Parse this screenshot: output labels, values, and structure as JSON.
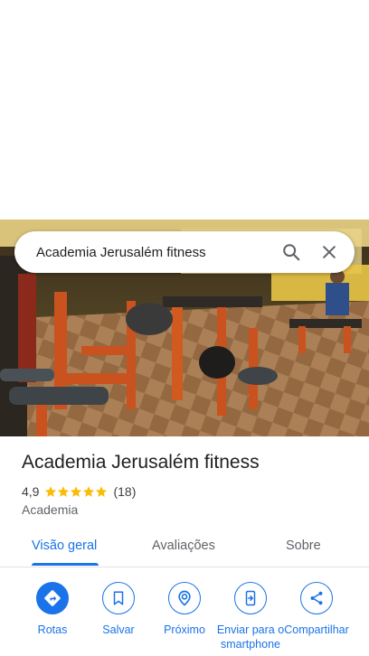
{
  "search": {
    "query": "Academia Jerusalém fitness",
    "search_icon": "search-icon",
    "close_icon": "close-icon"
  },
  "hero": {
    "photo": "gym-interior-photo"
  },
  "place": {
    "name": "Academia Jerusalém fitness",
    "rating": "4,9",
    "rating_value": 4.9,
    "stars": 5,
    "review_count": "(18)",
    "category": "Academia"
  },
  "tabs": [
    {
      "label": "Visão geral",
      "active": true
    },
    {
      "label": "Avaliações",
      "active": false
    },
    {
      "label": "Sobre",
      "active": false
    }
  ],
  "actions": [
    {
      "label": "Rotas",
      "icon": "directions-icon"
    },
    {
      "label": "Salvar",
      "icon": "bookmark-icon"
    },
    {
      "label": "Próximo",
      "icon": "nearby-icon"
    },
    {
      "label": "Enviar para o smartphone",
      "icon": "send-to-phone-icon"
    },
    {
      "label": "Compartilhar",
      "icon": "share-icon"
    }
  ],
  "colors": {
    "accent": "#1a73e8",
    "star": "#fbbc04",
    "text": "#202124",
    "muted": "#5f6368"
  }
}
